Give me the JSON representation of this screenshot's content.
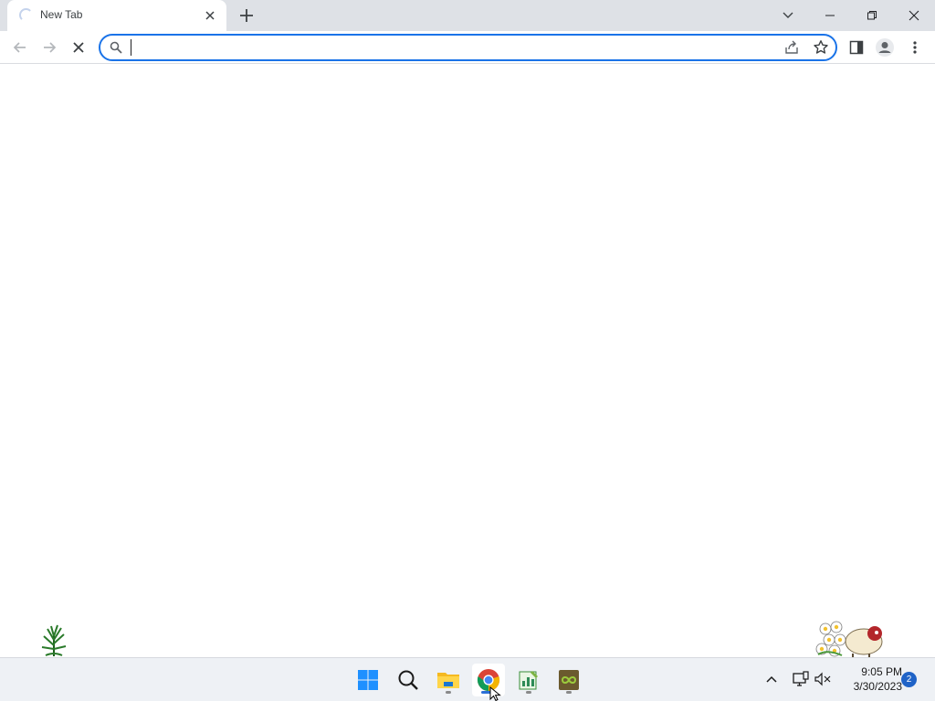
{
  "browser": {
    "tab": {
      "title": "New Tab"
    },
    "omnibox": {
      "value": "",
      "placeholder": ""
    }
  },
  "taskbar": {
    "apps": [
      {
        "name": "start",
        "icon": "windows-logo-icon"
      },
      {
        "name": "search",
        "icon": "search-icon"
      },
      {
        "name": "file-explorer",
        "icon": "folder-icon"
      },
      {
        "name": "chrome",
        "icon": "chrome-icon",
        "active": true
      },
      {
        "name": "app-chart",
        "icon": "chart-notepad-icon"
      },
      {
        "name": "app-infinity",
        "icon": "infinity-box-icon"
      }
    ],
    "clock": {
      "time": "9:05 PM",
      "date": "3/30/2023"
    },
    "notifications": {
      "count": "2"
    }
  },
  "colors": {
    "accent": "#1a73e8",
    "tabstrip": "#dee1e6",
    "taskbar": "#eef1f5"
  }
}
